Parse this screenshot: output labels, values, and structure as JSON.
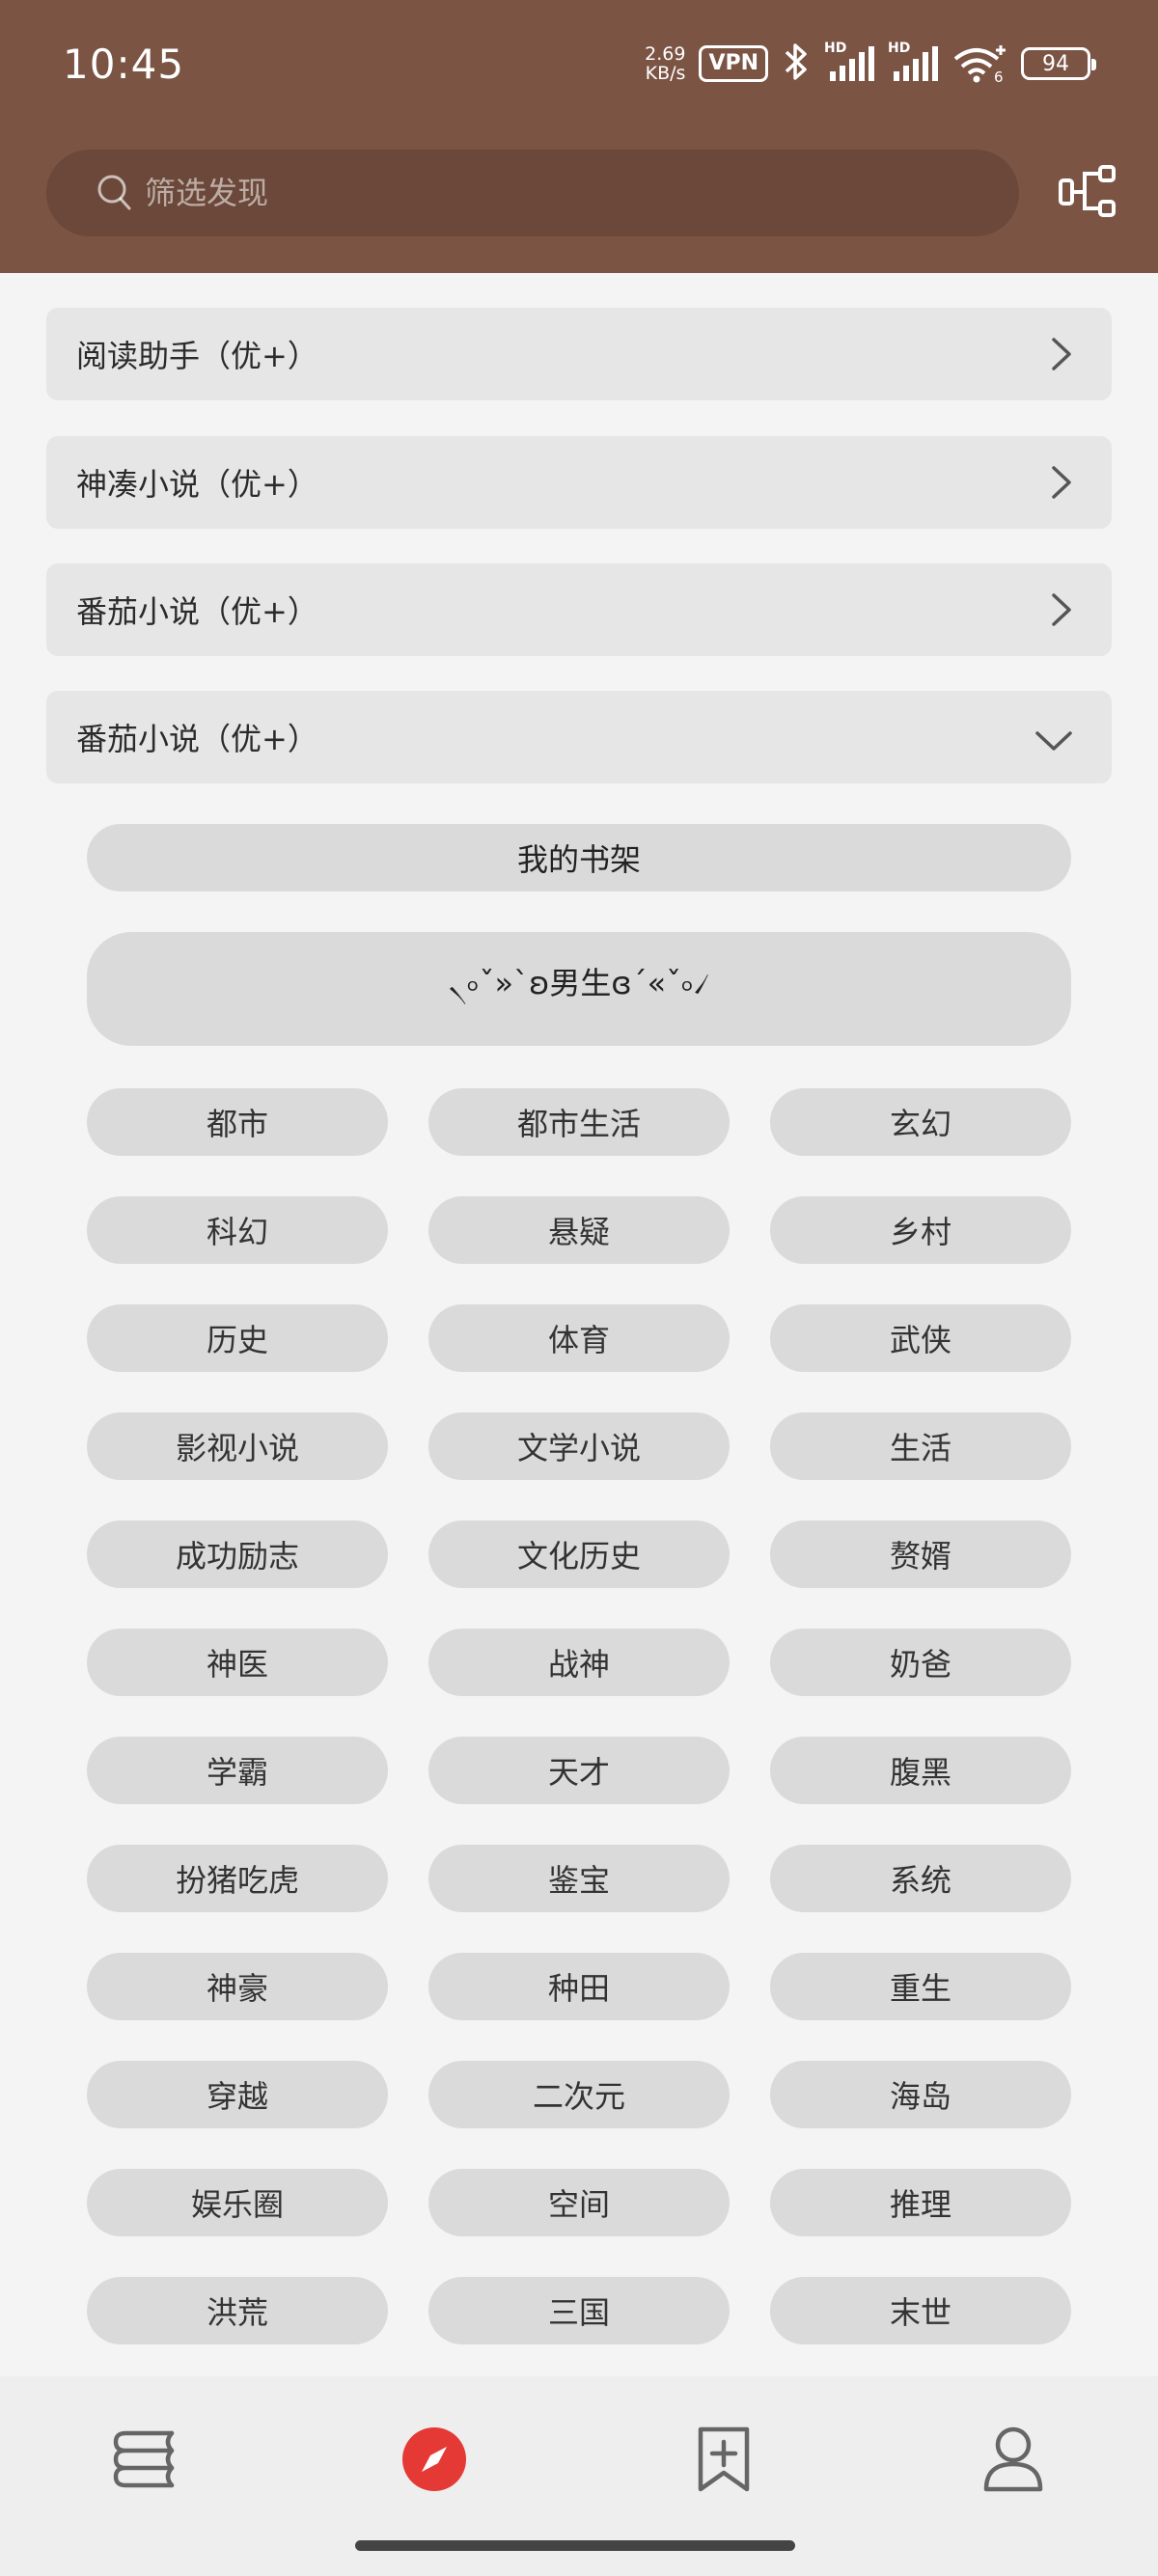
{
  "status_bar": {
    "time": "10:45",
    "net_speed_value": "2.69",
    "net_speed_unit": "KB/s",
    "vpn": "VPN",
    "signal_badge_1": "HD",
    "signal_badge_2": "HD",
    "wifi_badge": "6",
    "battery": "94"
  },
  "search": {
    "placeholder": "筛选发现",
    "value": ""
  },
  "groups": [
    {
      "label": "阅读助手（优+）",
      "expanded": false
    },
    {
      "label": "神凑小说（优+）",
      "expanded": false
    },
    {
      "label": "番茄小说（优+）",
      "expanded": false
    },
    {
      "label": "番茄小说（优+）",
      "expanded": true
    }
  ],
  "expanded_group": {
    "bookshelf": "我的书架",
    "section_title": "৲৹ˇ»`ʚ男生ɞ´«ˇ৹৴",
    "categories": [
      "都市",
      "都市生活",
      "玄幻",
      "科幻",
      "悬疑",
      "乡村",
      "历史",
      "体育",
      "武侠",
      "影视小说",
      "文学小说",
      "生活",
      "成功励志",
      "文化历史",
      "赘婿",
      "神医",
      "战神",
      "奶爸",
      "学霸",
      "天才",
      "腹黑",
      "扮猪吃虎",
      "鉴宝",
      "系统",
      "神豪",
      "种田",
      "重生",
      "穿越",
      "二次元",
      "海岛",
      "娱乐圈",
      "空间",
      "推理",
      "洪荒",
      "三国",
      "末世"
    ]
  },
  "bottom_nav": {
    "items": [
      {
        "icon": "bookshelf-icon",
        "active": false
      },
      {
        "icon": "compass-icon",
        "active": true
      },
      {
        "icon": "bookmark-add-icon",
        "active": false
      },
      {
        "icon": "user-icon",
        "active": false
      }
    ]
  },
  "colors": {
    "header": "#7b5444",
    "accent": "#e53935",
    "row_bg": "#e6e6e6",
    "pill_bg": "#dadada",
    "page_bg": "#f4f4f4"
  }
}
